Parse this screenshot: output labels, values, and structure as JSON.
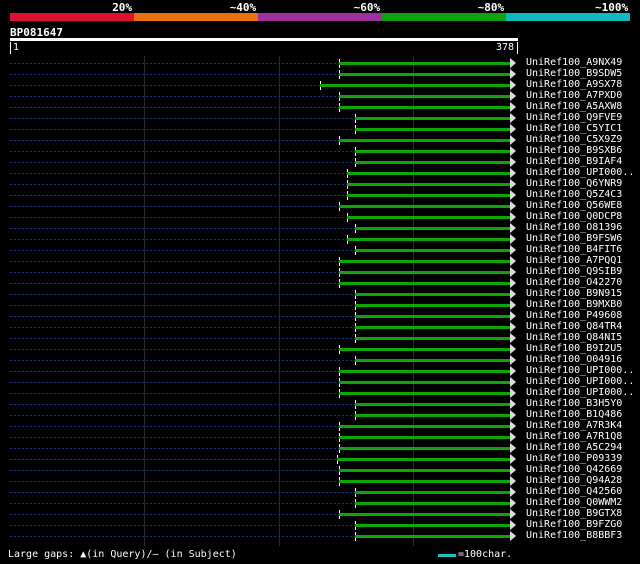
{
  "legend": {
    "segments": [
      {
        "label": "20%",
        "color": "#e01030"
      },
      {
        "label": "~40%",
        "color": "#e87010"
      },
      {
        "label": "~60%",
        "color": "#a030a0"
      },
      {
        "label": "~80%",
        "color": "#10a010"
      },
      {
        "label": "~100%",
        "color": "#10b8c0"
      }
    ]
  },
  "query": {
    "name": "BP081647",
    "start": "1",
    "end": "378",
    "length": 378
  },
  "hits": [
    {
      "name": "UniRef100_A9NX49",
      "start": 246
    },
    {
      "name": "UniRef100_B9SDW5",
      "start": 246
    },
    {
      "name": "UniRef100_A9SX78",
      "start": 232
    },
    {
      "name": "UniRef100_A7PXD0",
      "start": 246
    },
    {
      "name": "UniRef100_A5AXW8",
      "start": 246
    },
    {
      "name": "UniRef100_Q9FVE9",
      "start": 258
    },
    {
      "name": "UniRef100_C5YIC1",
      "start": 258
    },
    {
      "name": "UniRef100_C5X9Z9",
      "start": 246
    },
    {
      "name": "UniRef100_B9SXB6",
      "start": 258
    },
    {
      "name": "UniRef100_B9IAF4",
      "start": 258
    },
    {
      "name": "UniRef100_UPI000..",
      "start": 252
    },
    {
      "name": "UniRef100_Q6YNR9",
      "start": 252
    },
    {
      "name": "UniRef100_Q5Z4C3",
      "start": 252
    },
    {
      "name": "UniRef100_Q56WE8",
      "start": 246
    },
    {
      "name": "UniRef100_Q0DCP8",
      "start": 252
    },
    {
      "name": "UniRef100_O81396",
      "start": 258
    },
    {
      "name": "UniRef100_B9FSW6",
      "start": 252
    },
    {
      "name": "UniRef100_B4FIT6",
      "start": 258
    },
    {
      "name": "UniRef100_A7PQQ1",
      "start": 246
    },
    {
      "name": "UniRef100_Q9SIB9",
      "start": 246
    },
    {
      "name": "UniRef100_O42270",
      "start": 246
    },
    {
      "name": "UniRef100_B9N915",
      "start": 258
    },
    {
      "name": "UniRef100_B9MXB0",
      "start": 258
    },
    {
      "name": "UniRef100_P49608",
      "start": 258
    },
    {
      "name": "UniRef100_Q84TR4",
      "start": 258
    },
    {
      "name": "UniRef100_Q84NI5",
      "start": 258
    },
    {
      "name": "UniRef100_B9I2U5",
      "start": 246
    },
    {
      "name": "UniRef100_O04916",
      "start": 258
    },
    {
      "name": "UniRef100_UPI000..",
      "start": 246
    },
    {
      "name": "UniRef100_UPI000..",
      "start": 246
    },
    {
      "name": "UniRef100_UPI000..",
      "start": 246
    },
    {
      "name": "UniRef100_B3H5Y0",
      "start": 258
    },
    {
      "name": "UniRef100_B1Q486",
      "start": 258
    },
    {
      "name": "UniRef100_A7R3K4",
      "start": 246
    },
    {
      "name": "UniRef100_A7R1Q8",
      "start": 246
    },
    {
      "name": "UniRef100_A5C294",
      "start": 246
    },
    {
      "name": "UniRef100_P09339",
      "start": 244
    },
    {
      "name": "UniRef100_Q42669",
      "start": 246
    },
    {
      "name": "UniRef100_Q94A28",
      "start": 246
    },
    {
      "name": "UniRef100_Q42560",
      "start": 258
    },
    {
      "name": "UniRef100_Q0WWM2",
      "start": 258
    },
    {
      "name": "UniRef100_B9GTX8",
      "start": 246
    },
    {
      "name": "UniRef100_B9FZG0",
      "start": 258
    },
    {
      "name": "UniRef100_B8BBF3",
      "start": 258
    }
  ],
  "footer": {
    "gaps_text": "Large gaps: ▲(in Query)/— (in Subject)",
    "scale_text": "=100char.",
    "scale_color": "#20c0c0"
  }
}
